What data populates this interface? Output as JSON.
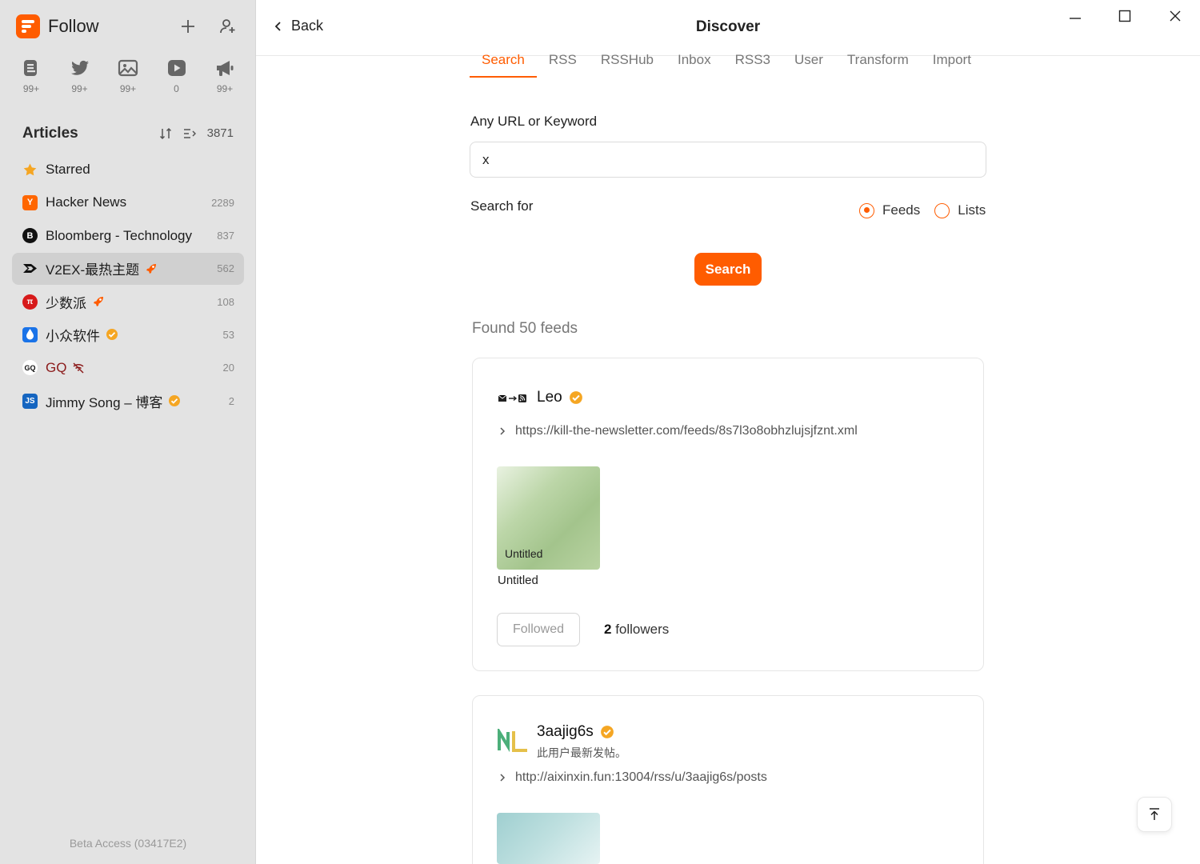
{
  "app": {
    "name": "Follow",
    "accent": "#ff5c00"
  },
  "views": [
    {
      "icon": "article-icon",
      "count": "99+"
    },
    {
      "icon": "twitter-icon",
      "count": "99+"
    },
    {
      "icon": "picture-icon",
      "count": "99+"
    },
    {
      "icon": "video-icon",
      "count": "0"
    },
    {
      "icon": "megaphone-icon",
      "count": "99+"
    }
  ],
  "sidebar": {
    "section_title": "Articles",
    "total": "3871",
    "feeds": [
      {
        "name": "Starred",
        "count": "",
        "icon": "star-icon"
      },
      {
        "name": "Hacker News",
        "count": "2289",
        "icon": "hacker-news-icon"
      },
      {
        "name": "Bloomberg - Technology",
        "count": "837",
        "icon": "bloomberg-icon"
      },
      {
        "name": "V2EX-最热主题",
        "count": "562",
        "icon": "v2ex-icon",
        "badge": "rocket-icon",
        "active": true
      },
      {
        "name": "少数派",
        "count": "108",
        "icon": "sspai-icon",
        "badge": "rocket-icon"
      },
      {
        "name": "小众软件",
        "count": "53",
        "icon": "appinn-icon",
        "badge": "verified-icon"
      },
      {
        "name": "GQ",
        "count": "20",
        "icon": "gq-icon",
        "badge": "no-signal-icon"
      },
      {
        "name": "Jimmy Song – 博客",
        "count": "2",
        "icon": "js-icon",
        "badge": "verified-icon"
      }
    ],
    "beta": "Beta Access (03417E2)"
  },
  "header": {
    "back": "Back",
    "title": "Discover"
  },
  "tabs": [
    "Search",
    "RSS",
    "RSSHub",
    "Inbox",
    "RSS3",
    "User",
    "Transform",
    "Import"
  ],
  "form": {
    "url_label": "Any URL or Keyword",
    "url_value": "x",
    "search_for_label": "Search for",
    "options": [
      "Feeds",
      "Lists"
    ],
    "selected": "Feeds",
    "search_button": "Search"
  },
  "results": {
    "found": "Found 50 feeds",
    "cards": [
      {
        "title": "Leo",
        "description": "",
        "url": "https://kill-the-newsletter.com/feeds/8s7l3o8obhzlujsjfznt.xml",
        "entry_label": "Untitled",
        "entry_caption": "Untitled",
        "follow_label": "Followed",
        "followers_count": "2",
        "followers_text": "followers"
      },
      {
        "title": "3aajig6s",
        "description": "此用户最新发帖。",
        "url": "http://aixinxin.fun:13004/rss/u/3aajig6s/posts"
      }
    ]
  }
}
